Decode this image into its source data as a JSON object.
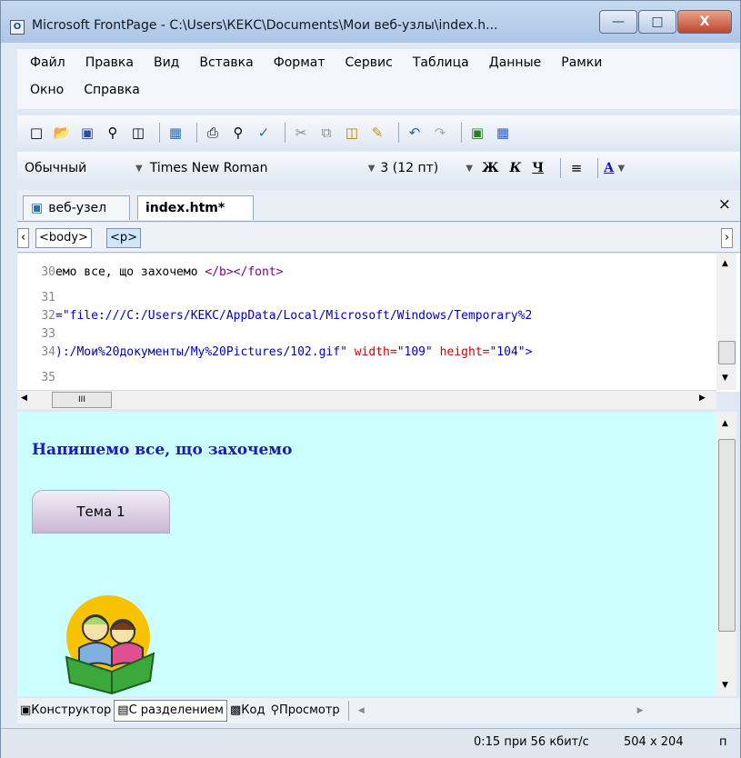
{
  "window": {
    "title": "Microsoft FrontPage - C:\\Users\\КЕКС\\Documents\\Мои веб-узлы\\index.h...",
    "app_icon_label": "Ο",
    "minimize_glyph": "—",
    "maximize_glyph": "□",
    "close_glyph": "X"
  },
  "menu": {
    "row1": [
      "Файл",
      "Правка",
      "Вид",
      "Вставка",
      "Формат",
      "Сервис",
      "Таблица",
      "Данные",
      "Рамки"
    ],
    "row2": [
      "Окно",
      "Справка"
    ]
  },
  "toolbar": {
    "icons": [
      "new-page-icon",
      "open-icon",
      "save-icon",
      "find-icon",
      "preview-icon",
      "web-component-icon",
      "print-icon",
      "print-preview-icon",
      "spelling-icon",
      "cut-icon",
      "copy-icon",
      "paste-icon",
      "format-painter-icon",
      "undo-icon",
      "redo-icon",
      "insert-image-icon",
      "insert-table-icon"
    ]
  },
  "format": {
    "style": "Обычный",
    "font": "Times New Roman",
    "size": "3 (12 пт)",
    "bold": "Ж",
    "italic": "К",
    "underline": "Ч",
    "color_letter": "А"
  },
  "tabs": {
    "site": "веб-узел",
    "file": "index.htm*",
    "close_glyph": "×"
  },
  "tags": {
    "left_arrow": "‹",
    "body": "<body>",
    "p": "<p>",
    "right_arrow": "›"
  },
  "code": {
    "lines": [
      {
        "num": "30",
        "text": "емо все, що захочемо ",
        "tag": "</b></font>"
      },
      {
        "num": "31",
        "text": ""
      },
      {
        "num": "32",
        "text": "=\"file:///C:/Users/КЕКС/AppData/Local/Microsoft/Windows/Temporary%2"
      },
      {
        "num": "33",
        "text": ""
      },
      {
        "num": "34",
        "text": "):/Мои%20документы/My%20Pictures/102.gif\" ",
        "attr1": "width=",
        "val1": "\"109\"",
        "attr2": " height=",
        "val2": "\"104\">"
      },
      {
        "num": "35",
        "text": ""
      }
    ],
    "scroll_thumb_label": "III"
  },
  "page": {
    "heading": "Напишемо все, що захочемо",
    "nav_button": "Тема 1"
  },
  "views": {
    "design": "Конструктор",
    "split": "С разделением",
    "code": "Код",
    "preview": "Просмотр"
  },
  "status": {
    "download_time": "0:15 при 56 кбит/с",
    "page_size": "504 x 204",
    "mode": "п"
  },
  "colors": {
    "design_bg": "#ccffff",
    "heading_color": "#1a1ac0",
    "code_tag": "#800080",
    "code_attr": "#d00000",
    "code_value": "#0000c0"
  }
}
